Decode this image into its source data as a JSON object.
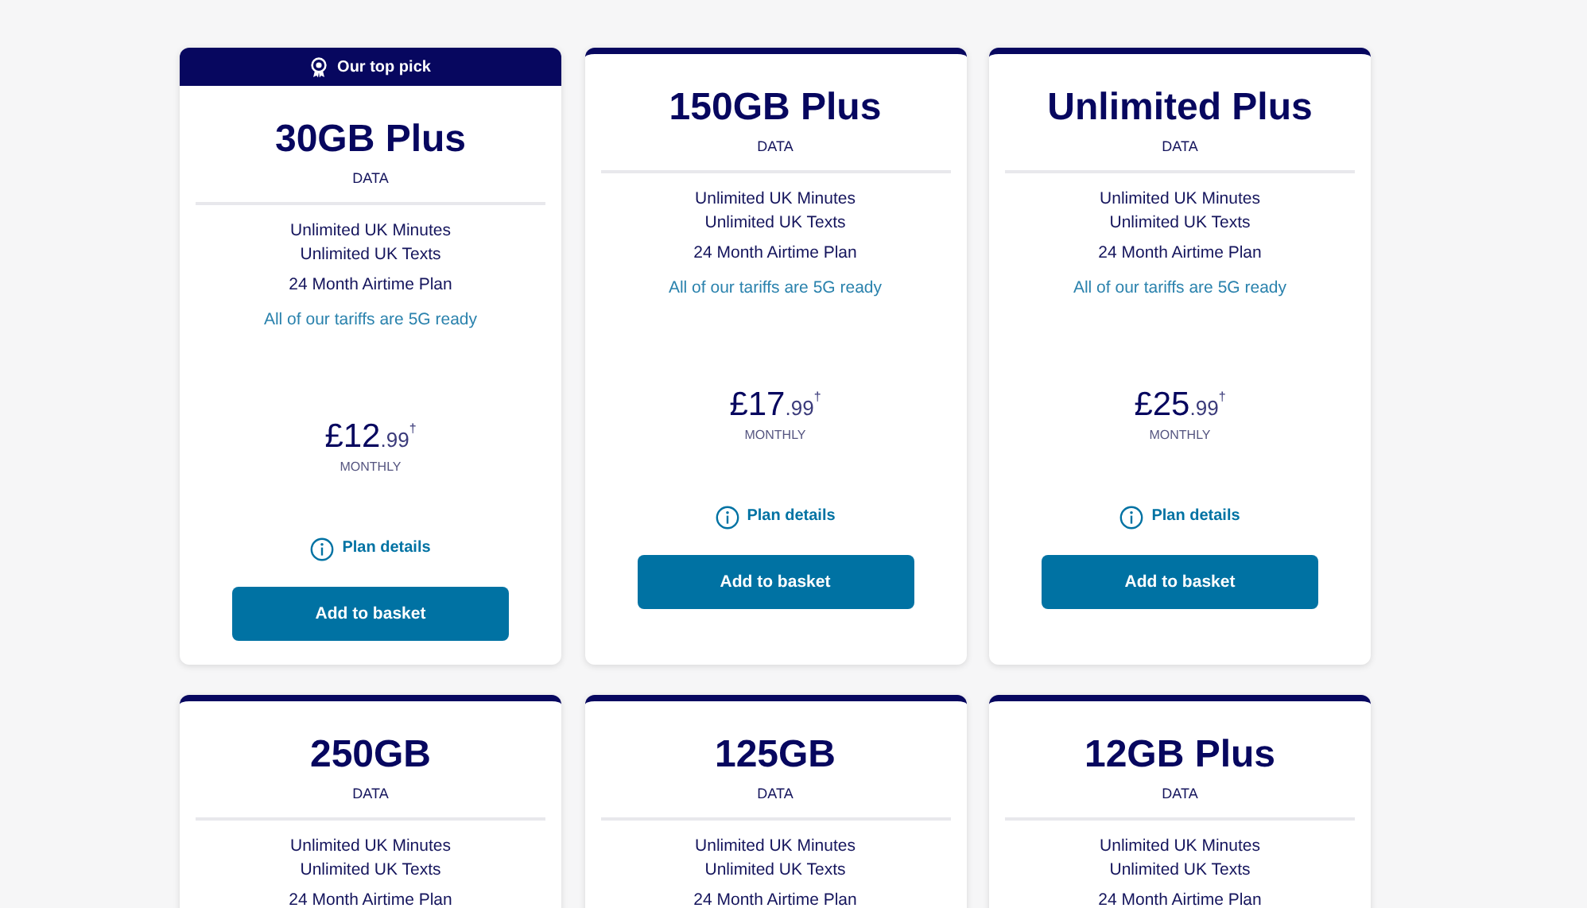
{
  "plans": [
    {
      "badge": "Our top pick",
      "name": "30GB Plus",
      "data_label": "DATA",
      "features": [
        "Unlimited UK Minutes",
        "Unlimited UK Texts"
      ],
      "term": "24 Month Airtime Plan",
      "note": "All of our tariffs are 5G ready",
      "price": {
        "main": "£12",
        "minor": ".99",
        "mark": "†"
      },
      "period": "MONTHLY",
      "details_link": "Plan details",
      "button": "Add to basket"
    },
    {
      "name": "150GB Plus",
      "data_label": "DATA",
      "features": [
        "Unlimited UK Minutes",
        "Unlimited UK Texts"
      ],
      "term": "24 Month Airtime Plan",
      "note": "All of our tariffs are 5G ready",
      "price": {
        "main": "£17",
        "minor": ".99",
        "mark": "†"
      },
      "period": "MONTHLY",
      "details_link": "Plan details",
      "button": "Add to basket"
    },
    {
      "name": "Unlimited Plus",
      "data_label": "DATA",
      "features": [
        "Unlimited UK Minutes",
        "Unlimited UK Texts"
      ],
      "term": "24 Month Airtime Plan",
      "note": "All of our tariffs are 5G ready",
      "price": {
        "main": "£25",
        "minor": ".99",
        "mark": "†"
      },
      "period": "MONTHLY",
      "details_link": "Plan details",
      "button": "Add to basket"
    },
    {
      "name": "250GB",
      "data_label": "DATA",
      "features": [
        "Unlimited UK Minutes",
        "Unlimited UK Texts"
      ],
      "term": "24 Month Airtime Plan"
    },
    {
      "name": "125GB",
      "data_label": "DATA",
      "features": [
        "Unlimited UK Minutes",
        "Unlimited UK Texts"
      ],
      "term": "24 Month Airtime Plan"
    },
    {
      "name": "12GB Plus",
      "data_label": "DATA",
      "features": [
        "Unlimited UK Minutes",
        "Unlimited UK Texts"
      ],
      "term": "24 Month Airtime Plan"
    }
  ]
}
